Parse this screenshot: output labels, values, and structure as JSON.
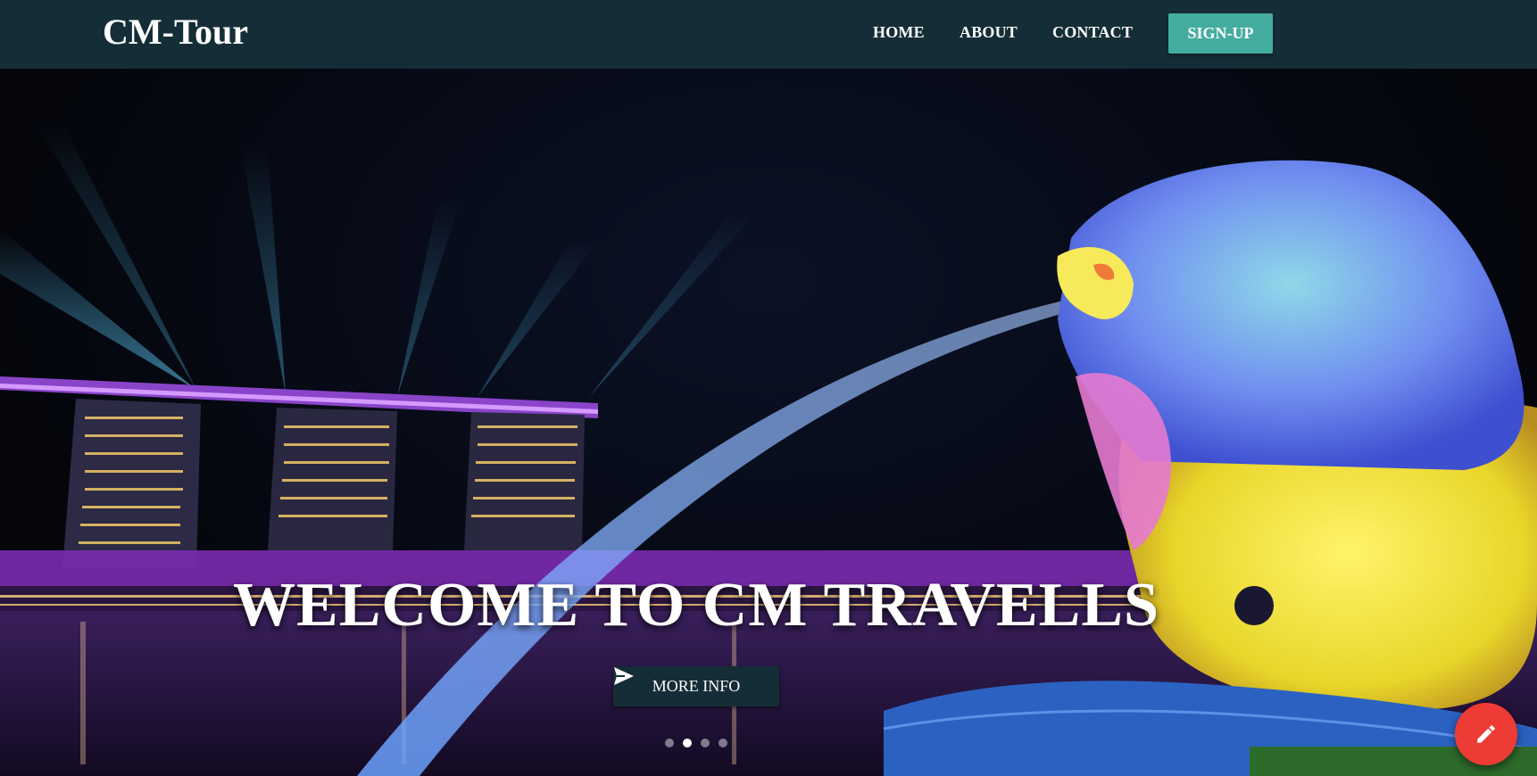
{
  "navbar": {
    "brand": "CM-Tour",
    "links": [
      {
        "label": "HOME"
      },
      {
        "label": "ABOUT"
      },
      {
        "label": "CONTACT"
      }
    ],
    "signup_label": "SIGN-UP",
    "background_color": "#152d36",
    "signup_color": "#45ada0"
  },
  "hero": {
    "headline": "WELCOME TO CM TRAVELLS",
    "cta_label": "MORE INFO",
    "cta_icon": "send-icon",
    "carousel": {
      "slide_count": 4,
      "active_index": 1
    }
  },
  "fab": {
    "icon": "pencil-icon",
    "color": "#ee3b35"
  }
}
